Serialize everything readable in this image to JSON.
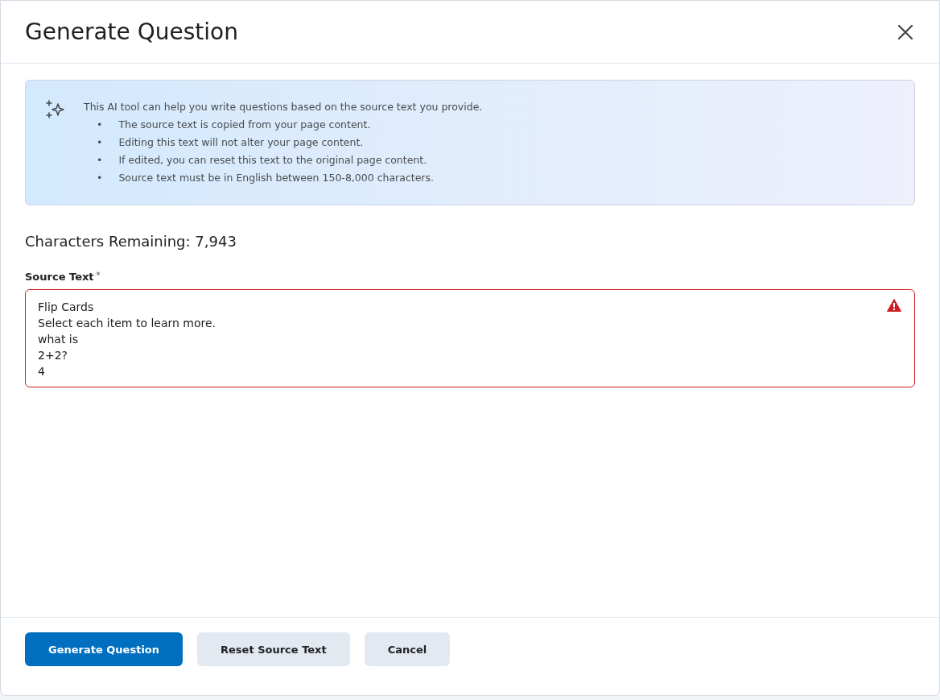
{
  "dialog": {
    "title": "Generate Question"
  },
  "info": {
    "intro": "This AI tool can help you write questions based on the source text you provide.",
    "bullets": [
      {
        "marker": "•",
        "text": "The source text is copied from your page content."
      },
      {
        "marker": "•",
        "text": "Editing this text will not alter your page content."
      },
      {
        "marker": "•",
        "text": "If edited, you can reset this text to the original page content."
      },
      {
        "marker": "•",
        "text": "Source text must be in English between 150-8,000 characters."
      }
    ]
  },
  "characters_remaining": "Characters Remaining: 7,943",
  "source_field": {
    "label": "Source Text",
    "required_mark": "*",
    "value": "Flip Cards\nSelect each item to learn more.\nwhat is\n2+2?\n4",
    "invalid": true
  },
  "buttons": [
    {
      "label": "Generate Question",
      "kind": "primary"
    },
    {
      "label": "Reset Source Text",
      "kind": "secondary"
    },
    {
      "label": "Cancel",
      "kind": "secondary"
    }
  ]
}
